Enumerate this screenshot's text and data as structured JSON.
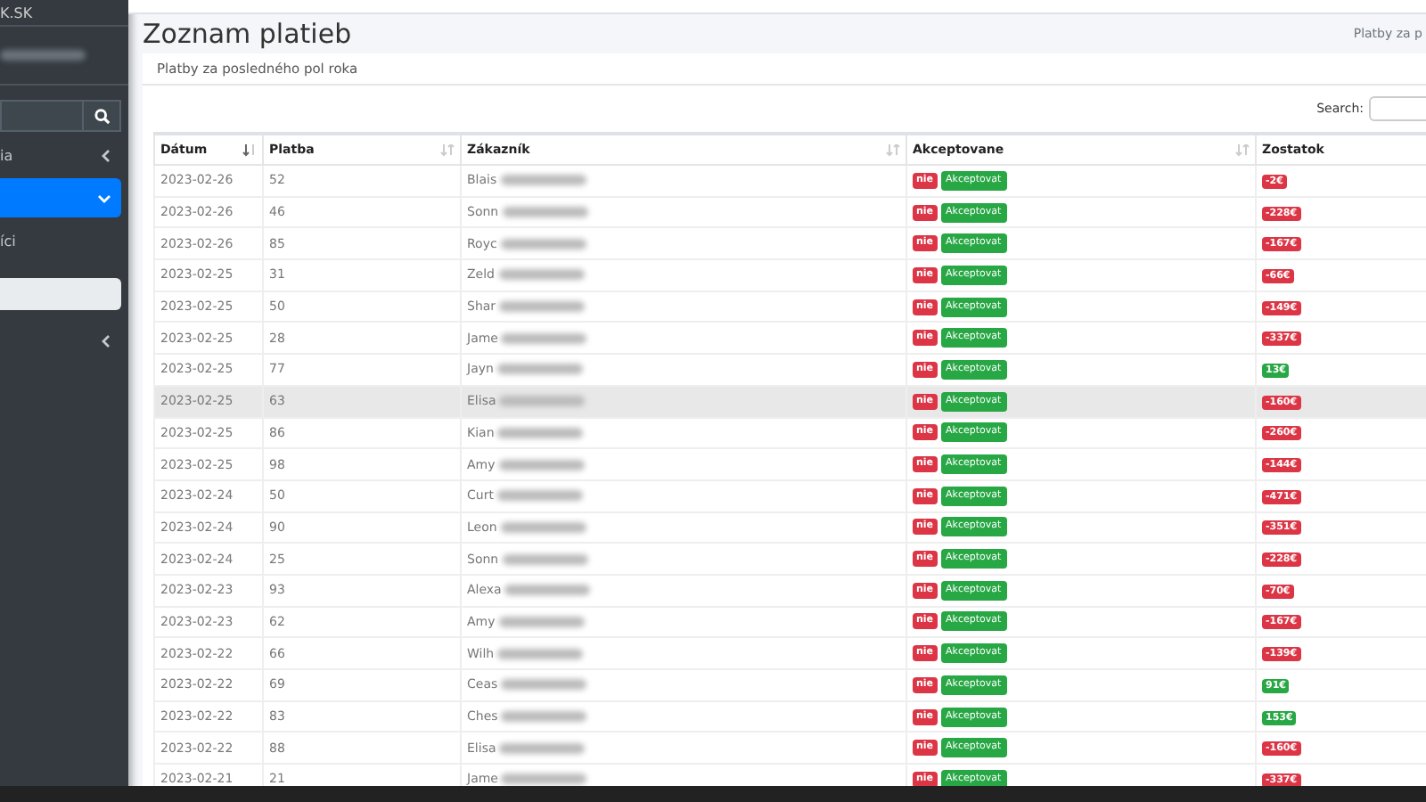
{
  "sidebar": {
    "brand": "K.SK",
    "items": [
      {
        "label": "ia",
        "kind": "collapsed",
        "selected": false
      },
      {
        "kind": "expanded",
        "selected": true
      },
      {
        "label": "íci",
        "kind": "plain",
        "selected": false
      },
      {
        "kind": "box",
        "selected": false
      },
      {
        "kind": "collapsed",
        "selected": false
      }
    ]
  },
  "page": {
    "title": "Zoznam platieb",
    "breadcrumb": "Platby za p"
  },
  "card": {
    "header": "Platby za posledného pol roka",
    "search_label": "Search:"
  },
  "table": {
    "columns": [
      {
        "label": "Dátum",
        "sortable": true,
        "sorted": true
      },
      {
        "label": "Platba",
        "sortable": true,
        "sorted": false
      },
      {
        "label": "Zákazník",
        "sortable": true,
        "sorted": false
      },
      {
        "label": "Akceptovane",
        "sortable": true,
        "sorted": false
      },
      {
        "label": "Zostatok"
      }
    ],
    "rows": [
      {
        "date": "2023-02-26",
        "amount": "52",
        "customer": "Blais",
        "status": "nie",
        "action": "Akceptovat",
        "balance": "-2€",
        "color": "#dc3545",
        "selected": false
      },
      {
        "date": "2023-02-26",
        "amount": "46",
        "customer": "Sonn",
        "status": "nie",
        "action": "Akceptovat",
        "balance": "-228€",
        "color": "#dc3545",
        "selected": false
      },
      {
        "date": "2023-02-26",
        "amount": "85",
        "customer": "Royc",
        "status": "nie",
        "action": "Akceptovat",
        "balance": "-167€",
        "color": "#dc3545",
        "selected": false
      },
      {
        "date": "2023-02-25",
        "amount": "31",
        "customer": "Zeld",
        "status": "nie",
        "action": "Akceptovat",
        "balance": "-66€",
        "color": "#dc3545",
        "selected": false
      },
      {
        "date": "2023-02-25",
        "amount": "50",
        "customer": "Shar",
        "status": "nie",
        "action": "Akceptovat",
        "balance": "-149€",
        "color": "#dc3545",
        "selected": false
      },
      {
        "date": "2023-02-25",
        "amount": "28",
        "customer": "Jame",
        "status": "nie",
        "action": "Akceptovat",
        "balance": "-337€",
        "color": "#dc3545",
        "selected": false
      },
      {
        "date": "2023-02-25",
        "amount": "77",
        "customer": "Jayn",
        "status": "nie",
        "action": "Akceptovat",
        "balance": "13€",
        "color": "#28a745",
        "selected": false
      },
      {
        "date": "2023-02-25",
        "amount": "63",
        "customer": "Elisa",
        "status": "nie",
        "action": "Akceptovat",
        "balance": "-160€",
        "color": "#dc3545",
        "selected": true
      },
      {
        "date": "2023-02-25",
        "amount": "86",
        "customer": "Kian",
        "status": "nie",
        "action": "Akceptovat",
        "balance": "-260€",
        "color": "#dc3545",
        "selected": false
      },
      {
        "date": "2023-02-25",
        "amount": "98",
        "customer": "Amy",
        "status": "nie",
        "action": "Akceptovat",
        "balance": "-144€",
        "color": "#dc3545",
        "selected": false
      },
      {
        "date": "2023-02-24",
        "amount": "50",
        "customer": "Curt",
        "status": "nie",
        "action": "Akceptovat",
        "balance": "-471€",
        "color": "#dc3545",
        "selected": false
      },
      {
        "date": "2023-02-24",
        "amount": "90",
        "customer": "Leon",
        "status": "nie",
        "action": "Akceptovat",
        "balance": "-351€",
        "color": "#dc3545",
        "selected": false
      },
      {
        "date": "2023-02-24",
        "amount": "25",
        "customer": "Sonn",
        "status": "nie",
        "action": "Akceptovat",
        "balance": "-228€",
        "color": "#dc3545",
        "selected": false
      },
      {
        "date": "2023-02-23",
        "amount": "93",
        "customer": "Alexa",
        "status": "nie",
        "action": "Akceptovat",
        "balance": "-70€",
        "color": "#dc3545",
        "selected": false
      },
      {
        "date": "2023-02-23",
        "amount": "62",
        "customer": "Amy",
        "status": "nie",
        "action": "Akceptovat",
        "balance": "-167€",
        "color": "#dc3545",
        "selected": false
      },
      {
        "date": "2023-02-22",
        "amount": "66",
        "customer": "Wilh",
        "status": "nie",
        "action": "Akceptovat",
        "balance": "-139€",
        "color": "#dc3545",
        "selected": false
      },
      {
        "date": "2023-02-22",
        "amount": "69",
        "customer": "Ceas",
        "status": "nie",
        "action": "Akceptovat",
        "balance": "91€",
        "color": "#28a745",
        "selected": false
      },
      {
        "date": "2023-02-22",
        "amount": "83",
        "customer": "Ches",
        "status": "nie",
        "action": "Akceptovat",
        "balance": "153€",
        "color": "#28a745",
        "selected": false
      },
      {
        "date": "2023-02-22",
        "amount": "88",
        "customer": "Elisa",
        "status": "nie",
        "action": "Akceptovat",
        "balance": "-160€",
        "color": "#dc3545",
        "selected": false
      },
      {
        "date": "2023-02-21",
        "amount": "21",
        "customer": "Jame",
        "status": "nie",
        "action": "Akceptovat",
        "balance": "-337€",
        "color": "#dc3545",
        "selected": false
      }
    ]
  }
}
